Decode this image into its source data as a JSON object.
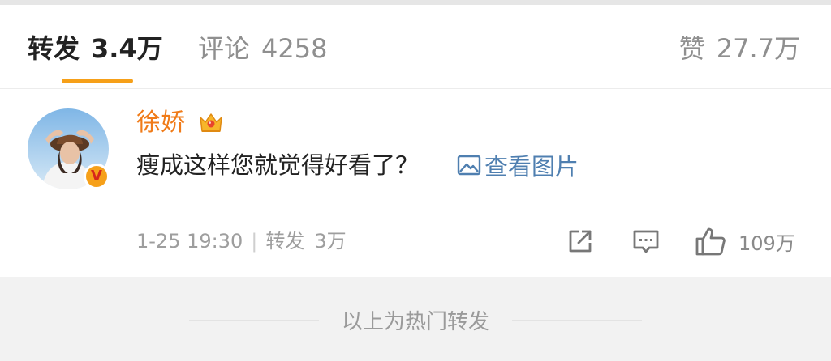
{
  "tabs": {
    "repost": {
      "label": "转发",
      "count": "3.4万"
    },
    "comments": {
      "label": "评论",
      "count": "4258"
    },
    "likes": {
      "label": "赞",
      "count": "27.7万"
    }
  },
  "post": {
    "username": "徐娇",
    "text": "瘦成这样您就觉得好看了？",
    "view_images_label": "查看图片",
    "verified_badge": "V",
    "timestamp": "1-25 19:30",
    "repost_label": "转发",
    "repost_count": "3万",
    "like_count": "109万"
  },
  "footer": {
    "text": "以上为热门转发"
  },
  "colors": {
    "accent": "#f6a019",
    "username": "#f07b18",
    "link": "#4f7fb0",
    "muted": "#9e9e9e"
  },
  "icons": {
    "member": "crown-icon",
    "images": "image-icon",
    "share": "share-icon",
    "comment": "comment-icon",
    "like": "thumbs-up-icon"
  }
}
